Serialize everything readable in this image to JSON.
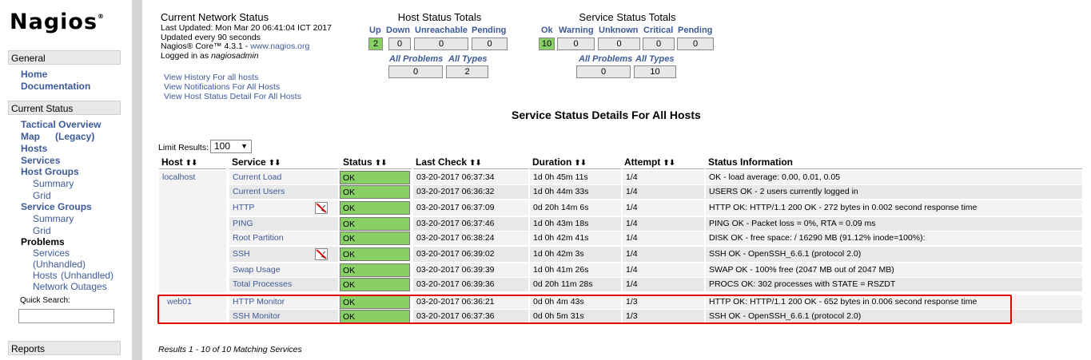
{
  "sidebar": {
    "logo": "Nagios",
    "logo_mark": "®",
    "general_header": "General",
    "home": "Home",
    "documentation": "Documentation",
    "current_status_header": "Current Status",
    "tactical_overview": "Tactical Overview",
    "map": "Map",
    "legacy": "(Legacy)",
    "hosts": "Hosts",
    "services": "Services",
    "host_groups": "Host Groups",
    "hg_summary": "Summary",
    "hg_grid": "Grid",
    "service_groups": "Service Groups",
    "sg_summary": "Summary",
    "sg_grid": "Grid",
    "problems": "Problems",
    "prob_services": "Services",
    "prob_unhandled": "(Unhandled)",
    "prob_hosts": "Hosts",
    "prob_hosts_unhandled": "(Unhandled)",
    "network_outages": "Network Outages",
    "quick_search_label": "Quick Search:",
    "reports_header": "Reports"
  },
  "network_status": {
    "title": "Current Network Status",
    "last_updated": "Last Updated: Mon Mar 20 06:41:04 ICT 2017",
    "update_interval": "Updated every 90 seconds",
    "version_prefix": "Nagios® Core™ 4.3.1 - ",
    "version_link": "www.nagios.org",
    "logged_prefix": "Logged in as ",
    "user": "nagiosadmin"
  },
  "view_links": [
    "View History For all hosts",
    "View Notifications For All Hosts",
    "View Host Status Detail For All Hosts"
  ],
  "host_totals": {
    "title": "Host Status Totals",
    "labels": [
      "Up",
      "Down",
      "Unreachable",
      "Pending"
    ],
    "values": [
      "2",
      "0",
      "0",
      "0"
    ],
    "all_problems_label": "All Problems",
    "all_types_label": "All Types",
    "all_problems": "0",
    "all_types": "2"
  },
  "service_totals": {
    "title": "Service Status Totals",
    "labels": [
      "Ok",
      "Warning",
      "Unknown",
      "Critical",
      "Pending"
    ],
    "values": [
      "10",
      "0",
      "0",
      "0",
      "0"
    ],
    "all_problems_label": "All Problems",
    "all_types_label": "All Types",
    "all_problems": "0",
    "all_types": "10"
  },
  "page_title": "Service Status Details For All Hosts",
  "limit": {
    "label": "Limit Results:",
    "value": "100",
    "arrow": "▼"
  },
  "sort_glyph": "⬆⬇",
  "table": {
    "headers": [
      "Host",
      "Service",
      "Status",
      "Last Check",
      "Duration",
      "Attempt",
      "Status Information"
    ],
    "rows": [
      {
        "host": "localhost",
        "service": "Current Load",
        "status": "OK",
        "last_check": "03-20-2017 06:37:34",
        "duration": "1d 0h 45m 11s",
        "attempt": "1/4",
        "info": "OK - load average: 0.00, 0.01, 0.05"
      },
      {
        "host": "",
        "service": "Current Users",
        "status": "OK",
        "last_check": "03-20-2017 06:36:32",
        "duration": "1d 0h 44m 33s",
        "attempt": "1/4",
        "info": "USERS OK - 2 users currently logged in"
      },
      {
        "host": "",
        "service": "HTTP",
        "status": "OK",
        "last_check": "03-20-2017 06:37:09",
        "duration": "0d 20h 14m 6s",
        "attempt": "1/4",
        "info": "HTTP OK: HTTP/1.1 200 OK - 272 bytes in 0.002 second response time"
      },
      {
        "host": "",
        "service": "PING",
        "status": "OK",
        "last_check": "03-20-2017 06:37:46",
        "duration": "1d 0h 43m 18s",
        "attempt": "1/4",
        "info": "PING OK - Packet loss = 0%, RTA = 0.09 ms"
      },
      {
        "host": "",
        "service": "Root Partition",
        "status": "OK",
        "last_check": "03-20-2017 06:38:24",
        "duration": "1d 0h 42m 41s",
        "attempt": "1/4",
        "info": "DISK OK - free space: / 16290 MB (91.12% inode=100%):"
      },
      {
        "host": "",
        "service": "SSH",
        "status": "OK",
        "last_check": "03-20-2017 06:39:02",
        "duration": "1d 0h 42m 3s",
        "attempt": "1/4",
        "info": "SSH OK - OpenSSH_6.6.1 (protocol 2.0)"
      },
      {
        "host": "",
        "service": "Swap Usage",
        "status": "OK",
        "last_check": "03-20-2017 06:39:39",
        "duration": "1d 0h 41m 26s",
        "attempt": "1/4",
        "info": "SWAP OK - 100% free (2047 MB out of 2047 MB)"
      },
      {
        "host": "",
        "service": "Total Processes",
        "status": "OK",
        "last_check": "03-20-2017 06:39:36",
        "duration": "0d 20h 11m 28s",
        "attempt": "1/4",
        "info": "PROCS OK: 302 processes with STATE = RSZDT"
      },
      {
        "host": "web01",
        "service": "HTTP Monitor",
        "status": "OK",
        "last_check": "03-20-2017 06:36:21",
        "duration": "0d 0h 4m 43s",
        "attempt": "1/3",
        "info": "HTTP OK: HTTP/1.1 200 OK - 652 bytes in 0.006 second response time"
      },
      {
        "host": "",
        "service": "SSH Monitor",
        "status": "OK",
        "last_check": "03-20-2017 06:37:36",
        "duration": "0d 0h 5m 31s",
        "attempt": "1/3",
        "info": "SSH OK - OpenSSH_6.6.1 (protocol 2.0)"
      }
    ]
  },
  "results": "Results 1 - 10 of 10 Matching Services",
  "colors": {
    "ok": "#88d066",
    "link": "#3c5a99",
    "highlight": "#e00000"
  }
}
